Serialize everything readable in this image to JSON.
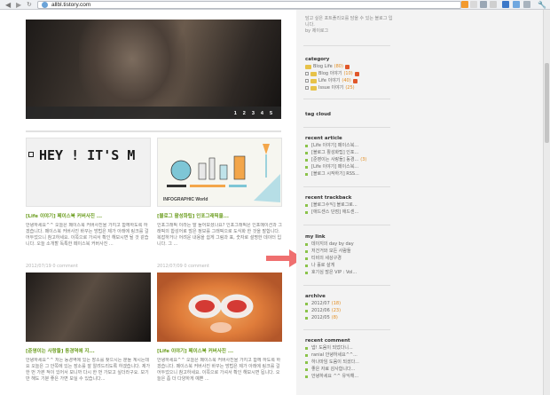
{
  "browser": {
    "url": "allbl.tistory.com"
  },
  "slider": {
    "pages": [
      "1",
      "2",
      "3",
      "4",
      "5"
    ]
  },
  "posts": [
    {
      "title": "[Life 이야기] 페이스북 커버사진 ...",
      "excerpt": "안녕하세요^^ 오늘은 페이스북 커버사진을 가지고 함께하도록 하겠습니다. 페이스북 커버사진 바꾸는 방법은 제가 아래에 링크를 걸어두었으니 참고하세요. 이쪽으로 가셔서 확인 해보시면 될 것 같습니다. 오늘 소개할 독특한 페이스북 커버사진 ...",
      "meta": "2012/07/19   0 comment"
    },
    {
      "title": "[블로그 활성화팁] 인포그래픽을...",
      "excerpt": "인포그래픽 이라는 말 들어보셨나요? 인포그래픽은 인포메이션과 그래픽의 합성어로 많은 정보를 그래픽으로 도식화 한 것을 말합니다. 복잡하거나 어려운 내용을 쉽게 그림과 표, 숫자로 설명한 데이터 입니다. 그 ...",
      "meta": "2012/07/09   0 comment"
    },
    {
      "title": "[준영이는 사랑들] 동경역에 지...",
      "excerpt": "안녕하세요^^ 저는 동경역에 있는 장소를 찾으시는 분들 계시는데요 오늘은 그 안쪽에 있는 장소를 잘 알려드리도록 하겠습니다. 제가 한 번 가본 적이 있어서 보니까 다시 한 번 가보고 싶더라구요. 보기만 해도 기분 좋은 가면 보실 수 있습니다...",
      "meta": ""
    },
    {
      "title": "[Life 이야기] 페이스북 커버사진 ...",
      "excerpt": "안녕하세요^^ 오늘은 페이스북 커버사진을 가지고 함께 하도록 하겠습니다. 페이스북 커버사진 바꾸는 방법은 제가 아래에 링크를 걸어두었으니 참고하세요. 이쪽으로 가셔서 확인 해보시면 됩니다. 오늘은 좀 더 다양하게 예쁜 ...",
      "meta": ""
    }
  ],
  "thumbs": {
    "hey_text": "HEY ! IT'S M",
    "info_caption": "INFOGRAPHIC World"
  },
  "sidebar": {
    "top_text": "담고 싶은 포트폴리오를 담을 수 있는 블로그 입니다.",
    "top_by": "by 제이로그",
    "category": {
      "heading": "category",
      "root": {
        "label": "Blog Life",
        "count": "(80)"
      },
      "children": [
        {
          "label": "Blog 이야기",
          "count": "(10)"
        },
        {
          "label": "Life 이야기",
          "count": "(40)"
        },
        {
          "label": "Issue 이야기",
          "count": "(25)"
        }
      ]
    },
    "tagcloud": {
      "heading": "tag cloud"
    },
    "recent_article": {
      "heading": "recent article",
      "items": [
        {
          "label": "[Life 이야기] 페이스북...",
          "count": ""
        },
        {
          "label": "[블로그 활성화팁] 인포...",
          "count": ""
        },
        {
          "label": "[준영이는 사랑들] 동경...",
          "count": "(3)"
        },
        {
          "label": "[Life 이야기] 페이스북...",
          "count": ""
        },
        {
          "label": "[블로그 시작하기] RSS...",
          "count": ""
        }
      ]
    },
    "recent_trackback": {
      "heading": "recent trackback",
      "items": [
        {
          "label": "[블로그수익] 블로그로..."
        },
        {
          "label": "[애드센스 단점] 애드센..."
        }
      ]
    },
    "my_link": {
      "heading": "my link",
      "items": [
        {
          "label": "데이지의 day by day"
        },
        {
          "label": "저건거와 모든 사람들"
        },
        {
          "label": "티비의 세상구경"
        },
        {
          "label": "나 홀로 살게"
        },
        {
          "label": "호기심 많은 VIP : Vol..."
        }
      ]
    },
    "archive": {
      "heading": "archive",
      "items": [
        {
          "label": "2012/07",
          "count": "(18)"
        },
        {
          "label": "2012/06",
          "count": "(23)"
        },
        {
          "label": "2012/05",
          "count": "(8)"
        }
      ]
    },
    "recent_comment": {
      "heading": "recent comment",
      "items": [
        {
          "label": "넵! 도움이 되었다니..."
        },
        {
          "label": "ranial 안녕하세요^^..."
        },
        {
          "label": "하나마임 도움이 되셨다..."
        },
        {
          "label": "좋은 자료 감사합니다..."
        },
        {
          "label": "안녕하세요 ^^ 유익해..."
        }
      ]
    }
  },
  "colors": {
    "accent_green": "#6b9d1e",
    "count_orange": "#e28a1b",
    "arrow_pink": "#ef6f6f"
  }
}
